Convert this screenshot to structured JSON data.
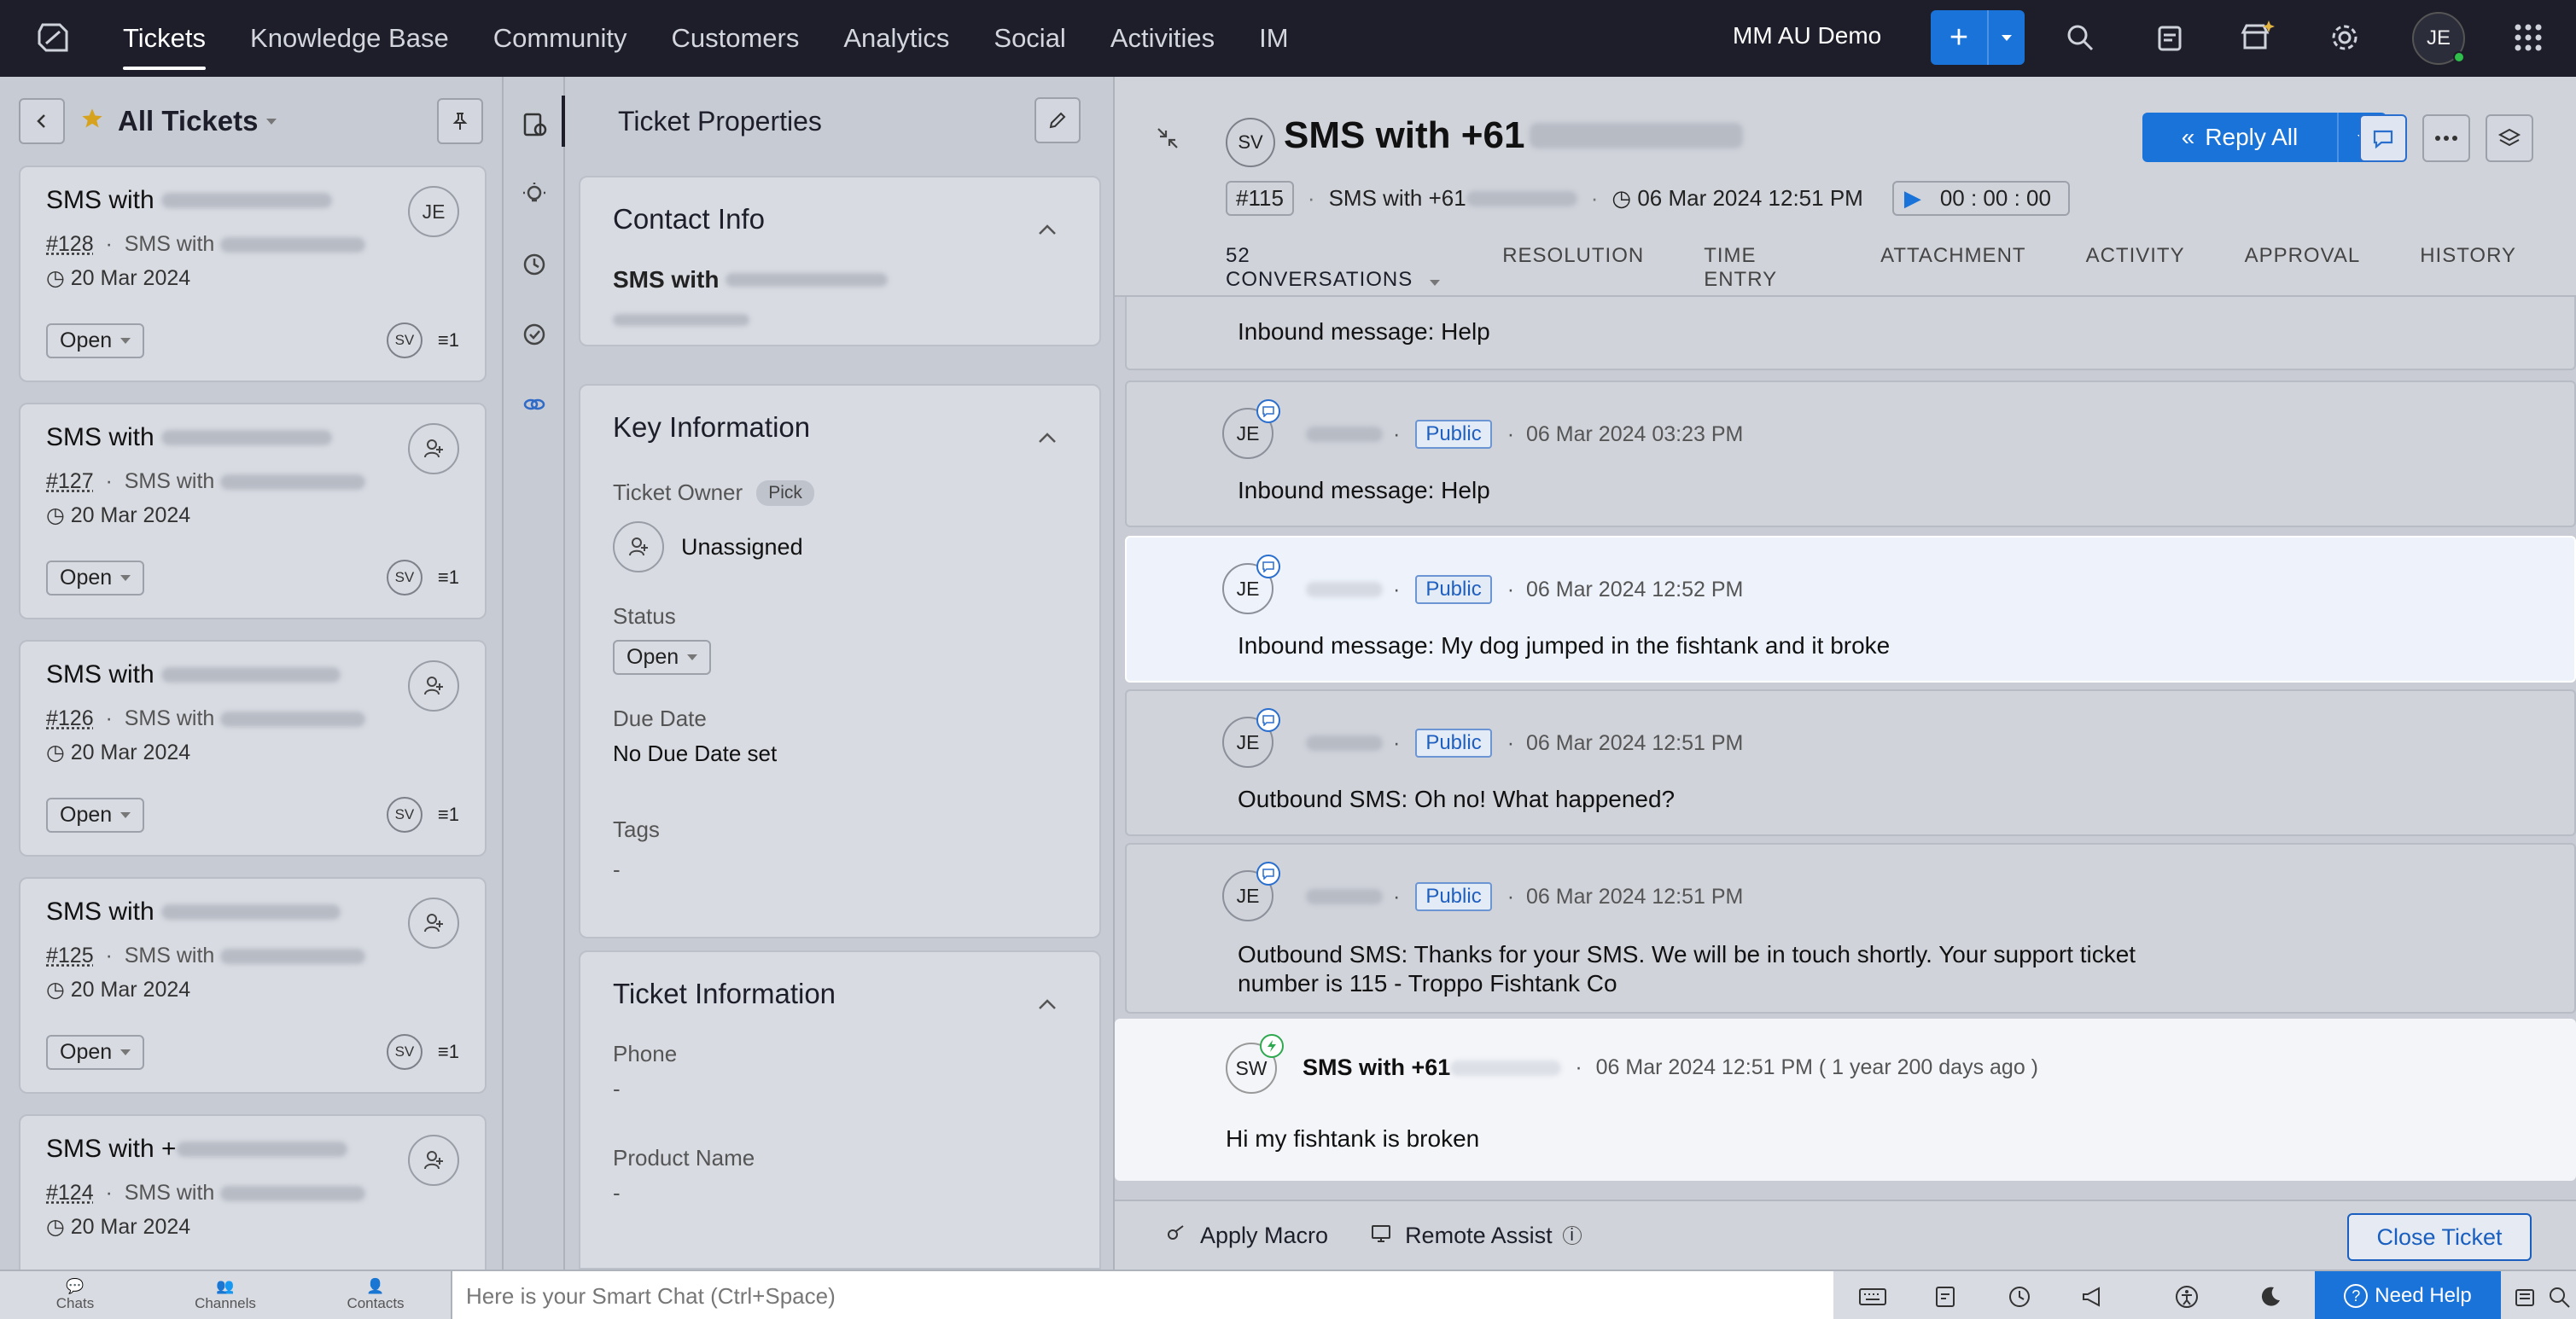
{
  "topnav": {
    "items": [
      "Tickets",
      "Knowledge Base",
      "Community",
      "Customers",
      "Analytics",
      "Social",
      "Activities",
      "IM"
    ],
    "org": "MM AU Demo",
    "user_initials": "JE",
    "plus": "+"
  },
  "left": {
    "view_title": "All Tickets",
    "tickets": [
      {
        "title": "SMS with",
        "number": "#128",
        "sub": "SMS with",
        "date": "20 Mar 2024",
        "status": "Open",
        "agent": "SV",
        "owner": "JE",
        "count": "1"
      },
      {
        "title": "SMS with",
        "number": "#127",
        "sub": "SMS with",
        "date": "20 Mar 2024",
        "status": "Open",
        "agent": "SV",
        "count": "1"
      },
      {
        "title": "SMS with",
        "number": "#126",
        "sub": "SMS with",
        "date": "20 Mar 2024",
        "status": "Open",
        "agent": "SV",
        "count": "1"
      },
      {
        "title": "SMS with",
        "number": "#125",
        "sub": "SMS with",
        "date": "20 Mar 2024",
        "status": "Open",
        "agent": "SV",
        "count": "1"
      },
      {
        "title": "SMS with +",
        "number": "#124",
        "sub": "SMS with",
        "date": "20 Mar 2024"
      }
    ]
  },
  "props": {
    "title": "Ticket Properties",
    "contact": {
      "heading": "Contact Info",
      "name": "SMS with"
    },
    "key": {
      "heading": "Key Information",
      "owner_label": "Ticket Owner",
      "pick": "Pick",
      "owner": "Unassigned",
      "status_label": "Status",
      "status": "Open",
      "due_label": "Due Date",
      "due": "No Due Date set",
      "tags_label": "Tags",
      "tags": "-"
    },
    "ticket_info": {
      "heading": "Ticket Information",
      "phone_label": "Phone",
      "phone": "-",
      "product_label": "Product Name",
      "product": "-"
    }
  },
  "main": {
    "sender_initials": "SV",
    "title": "SMS with +61",
    "reply_all": "Reply All",
    "ticket_no": "#115",
    "sub": "SMS with +61",
    "date": "06 Mar 2024 12:51 PM",
    "timer": "00 : 00 : 00",
    "tabs": [
      "52 CONVERSATIONS",
      "RESOLUTION",
      "TIME ENTRY",
      "ATTACHMENT",
      "ACTIVITY",
      "APPROVAL",
      "HISTORY"
    ],
    "conversations": [
      {
        "body": "Inbound message: Help"
      },
      {
        "initials": "JE",
        "visibility": "Public",
        "time": "06 Mar 2024 03:23 PM",
        "body": "Inbound message: Help"
      },
      {
        "initials": "JE",
        "visibility": "Public",
        "time": "06 Mar 2024 12:52 PM",
        "body": "Inbound message: My dog jumped in the fishtank and it broke"
      },
      {
        "initials": "JE",
        "visibility": "Public",
        "time": "06 Mar 2024 12:51 PM",
        "body": "Outbound SMS: Oh no! What happened?"
      },
      {
        "initials": "JE",
        "visibility": "Public",
        "time": "06 Mar 2024 12:51 PM",
        "body_line1": "Outbound SMS: Thanks for your SMS. We will be in touch shortly. Your support ticket",
        "body_line2": "number is 115 - Troppo Fishtank Co"
      },
      {
        "initials": "SW",
        "name": "SMS with +61",
        "time": "06 Mar 2024 12:51 PM ( 1 year 200 days ago )",
        "body": "Hi my fishtank is broken"
      }
    ],
    "bottom": {
      "apply_macro": "Apply Macro",
      "remote_assist": "Remote Assist",
      "close_ticket": "Close Ticket"
    }
  },
  "statusbar": {
    "chats": "Chats",
    "channels": "Channels",
    "contacts": "Contacts",
    "smart_chat": "Here is your Smart Chat (Ctrl+Space)",
    "need_help": "Need Help"
  }
}
